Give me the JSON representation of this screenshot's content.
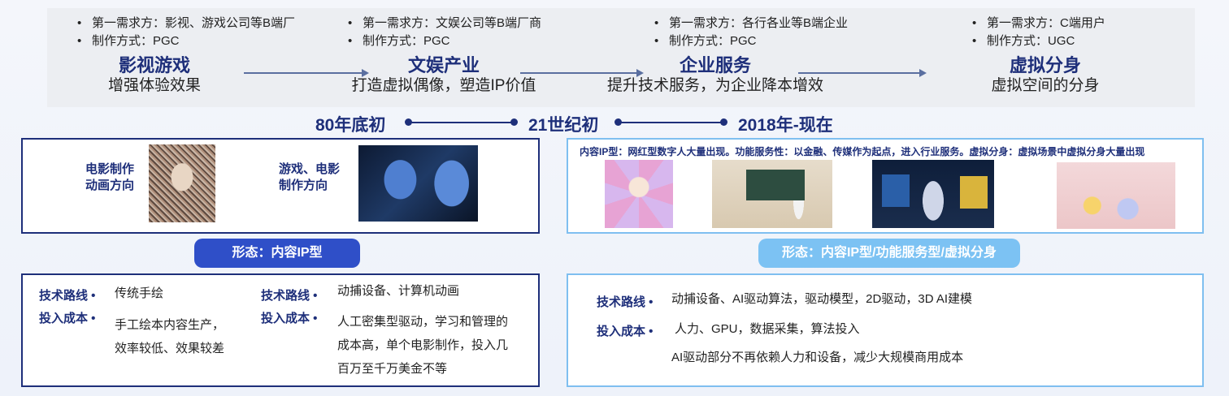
{
  "stages": [
    {
      "bullet1": "第一需求方：影视、游戏公司等B端厂",
      "bullet2": "制作方式：PGC",
      "title": "影视游戏",
      "subtitle": "增强体验效果"
    },
    {
      "bullet1": "第一需求方：文娱公司等B端厂商",
      "bullet2": "制作方式：PGC",
      "title": "文娱产业",
      "subtitle": "打造虚拟偶像，塑造IP价值"
    },
    {
      "bullet1": "第一需求方：各行各业等B端企业",
      "bullet2": "制作方式：PGC",
      "title": "企业服务",
      "subtitle": "提升技术服务，为企业降本增效"
    },
    {
      "bullet1": "第一需求方：C端用户",
      "bullet2": "制作方式：UGC",
      "title": "虚拟分身",
      "subtitle": "虚拟空间的分身"
    }
  ],
  "bullet_symbol": "•",
  "timeline": [
    "80年底初",
    "21世纪初",
    "2018年-现在"
  ],
  "left_panel": {
    "label1": "电影制作\n动画方向",
    "label2": "游戏、电影\n制作方向",
    "pill": "形态：内容IP型",
    "tech_label": "技术路线 •",
    "cost_label": "投入成本 •",
    "col1_tech": "传统手绘",
    "col1_cost": [
      "手工绘本内容生产，",
      "效率较低、效果较差"
    ],
    "col2_tech": "动捕设备、计算机动画",
    "col2_cost": [
      "人工密集型驱动，学习和管理的",
      "成本高，单个电影制作，投入几",
      "百万至千万美金不等"
    ]
  },
  "right_panel": {
    "note": "内容IP型：网红型数字人大量出现。功能服务性：以金融、传媒作为起点，进入行业服务。虚拟分身：虚拟场景中虚拟分身大量出现",
    "pill": "形态：内容IP型/功能服务型/虚拟分身",
    "tech_label": "技术路线 •",
    "cost_label": "投入成本 •",
    "tech": "动捕设备、AI驱动算法，驱动模型，2D驱动，3D AI建模",
    "cost": "人力、GPU，数据采集，算法投入",
    "cost2": "AI驱动部分不再依赖人力和设备，减少大规模商用成本"
  },
  "colors": {
    "navy": "#1e2f7a",
    "pill_dark": "#2f4fc8",
    "pill_light": "#7cc2f3",
    "box_light": "#7fbff0"
  }
}
